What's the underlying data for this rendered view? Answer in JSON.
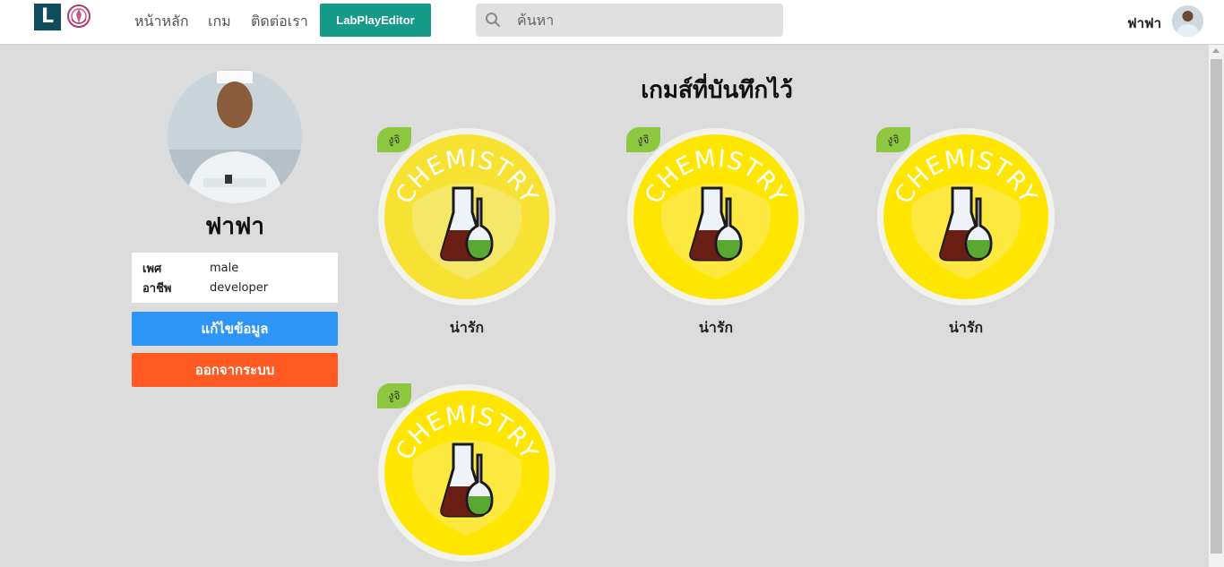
{
  "nav": {
    "logo_letter": "L",
    "links": [
      "หน้าหลัก",
      "เกม",
      "ติดต่อเรา"
    ],
    "editor_button": "LabPlayEditor",
    "search_placeholder": "ค้นหา",
    "user_name": "ฟาฟา"
  },
  "profile": {
    "name": "ฟาฟา",
    "info": [
      {
        "key": "เพศ",
        "value": "male"
      },
      {
        "key": "อาชีพ",
        "value": "developer"
      }
    ],
    "edit_button": "แก้ไขข้อมูล",
    "logout_button": "ออกจากระบบ"
  },
  "saved": {
    "title": "เกมส์ที่บันทึกไว้",
    "games": [
      {
        "badge": "งูจิ",
        "image_text": "CHEMISTRY",
        "label": "น่ารัก"
      },
      {
        "badge": "งูจิ",
        "image_text": "CHEMISTRY",
        "label": "น่ารัก"
      },
      {
        "badge": "งูจิ",
        "image_text": "CHEMISTRY",
        "label": "น่ารัก"
      },
      {
        "badge": "งูจิ",
        "image_text": "CHEMISTRY",
        "label": ""
      }
    ]
  },
  "colors": {
    "brand_teal": "#169b8a",
    "edit_blue": "#2c95f5",
    "logout_orange": "#ff5a22",
    "badge_green": "#8dc63f",
    "chem_yellow": "#ffe600"
  }
}
